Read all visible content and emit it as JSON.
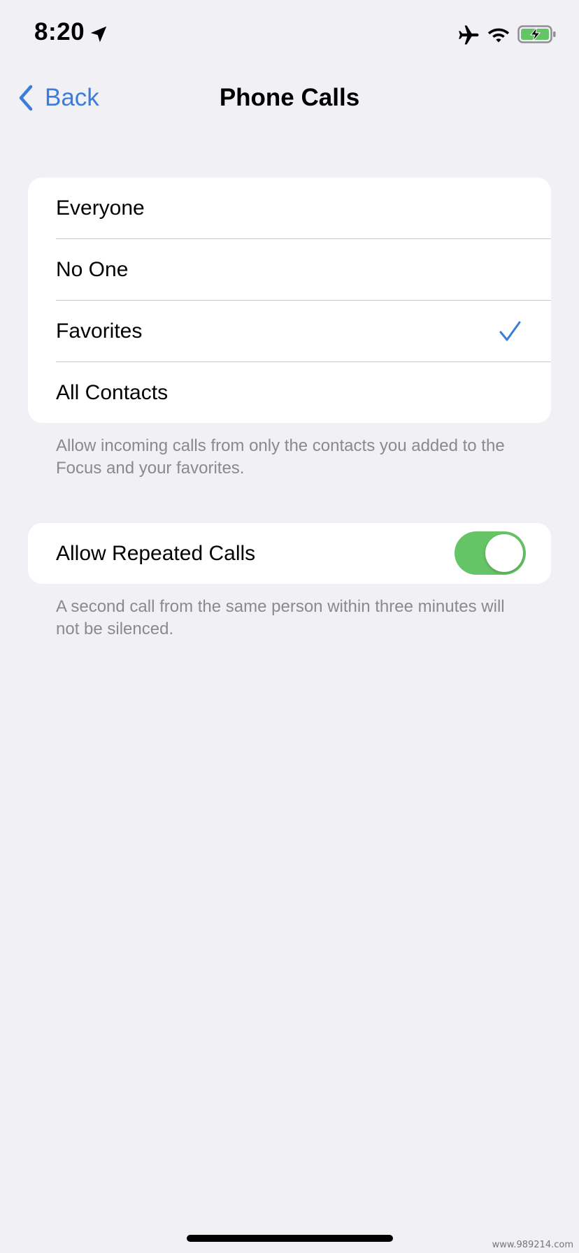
{
  "status_bar": {
    "time": "8:20",
    "icons": [
      "location-arrow-icon",
      "airplane-icon",
      "wifi-icon",
      "battery-charging-icon"
    ]
  },
  "nav": {
    "back_label": "Back",
    "title": "Phone Calls"
  },
  "options": {
    "items": [
      {
        "label": "Everyone",
        "selected": false
      },
      {
        "label": "No One",
        "selected": false
      },
      {
        "label": "Favorites",
        "selected": true
      },
      {
        "label": "All Contacts",
        "selected": false
      }
    ],
    "footer": "Allow incoming calls from only the contacts you added to the Focus and your favorites."
  },
  "repeated_calls": {
    "label": "Allow Repeated Calls",
    "enabled": true,
    "footer": "A second call from the same person within three minutes will not be silenced."
  },
  "watermark": "www.989214.com",
  "colors": {
    "accent": "#3a7ddb",
    "toggle_on": "#65c466",
    "background": "#f0f0f5",
    "secondary_text": "#8a8a8e"
  }
}
